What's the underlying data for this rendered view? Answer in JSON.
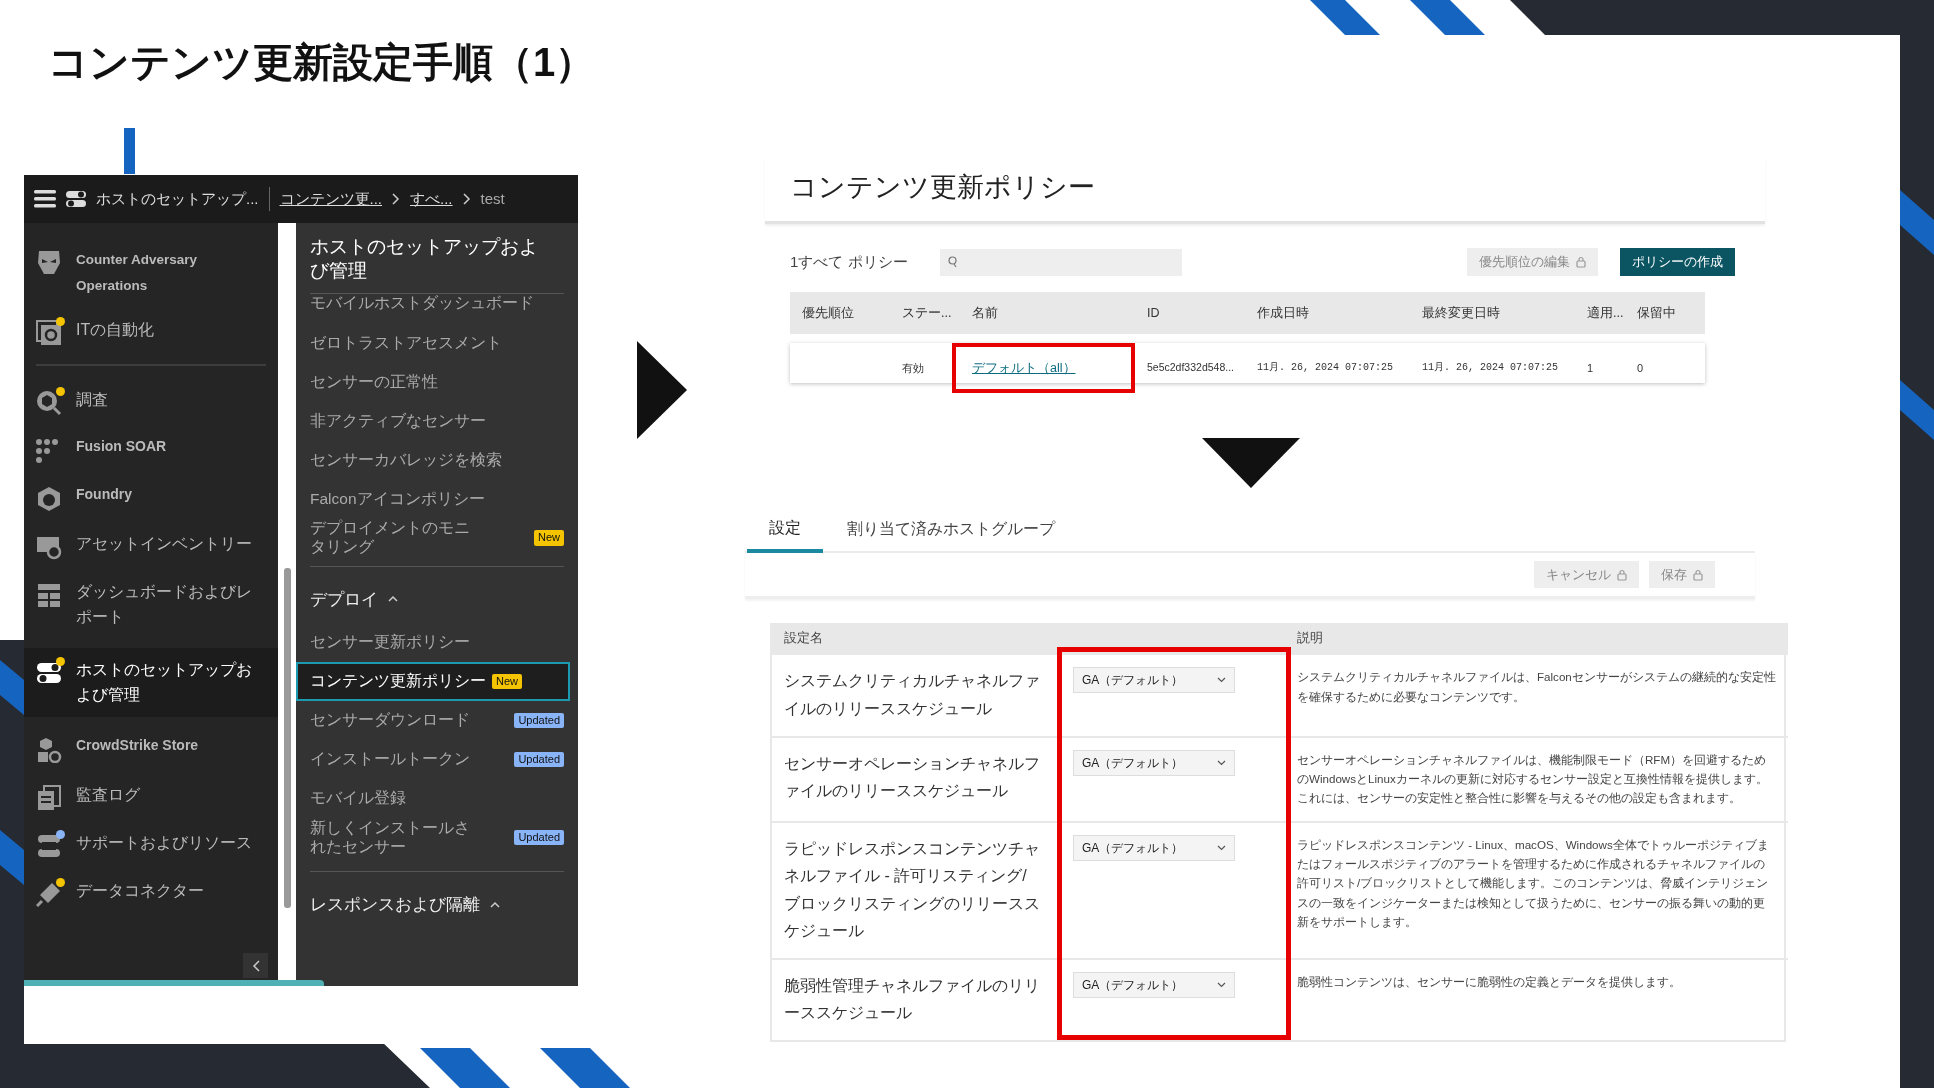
{
  "slide_title": "コンテンツ更新設定手順（1）",
  "console": {
    "breadcrumb": [
      {
        "text": "ホストのセットアップ...",
        "link": false
      },
      {
        "text": "コンテンツ更...",
        "link": true
      },
      {
        "text": "すべ...",
        "link": true
      },
      {
        "text": "test",
        "link": false
      }
    ],
    "nav_groups": [
      {
        "items": [
          {
            "label": "Counter Adversary Operations",
            "selected": false
          },
          {
            "label": "ITの自動化",
            "selected": false,
            "color": "#f5c400"
          }
        ]
      },
      {
        "items": [
          {
            "label": "調査",
            "selected": false,
            "color": "#f5c400"
          },
          {
            "label": "Fusion SOAR",
            "selected": false
          },
          {
            "label": "Foundry",
            "selected": false
          },
          {
            "label": "アセットインベントリー",
            "selected": false
          },
          {
            "label": "ダッシュボードおよびレポート",
            "selected": false
          },
          {
            "label": "ホストのセットアップおよび管理",
            "selected": true,
            "color": "#f5c400"
          },
          {
            "label": "CrowdStrike Store",
            "selected": false
          },
          {
            "label": "監査ログ",
            "selected": false
          },
          {
            "label": "サポートおよびリソース",
            "selected": false,
            "color": "#8ab4f8"
          },
          {
            "label": "データコネクター",
            "selected": false,
            "color": "#f5c400"
          }
        ]
      }
    ],
    "submenu": {
      "title": "ホストのセットアップおよび管理",
      "sections": [
        {
          "items": [
            {
              "label": "モバイルホストダッシュボード",
              "selected": false
            },
            {
              "label": "ゼロトラストアセスメント",
              "selected": false
            },
            {
              "label": "センサーの正常性",
              "selected": false
            },
            {
              "label": "非アクティブなセンサー",
              "selected": false
            },
            {
              "label": "センサーカバレッジを検索",
              "selected": false
            },
            {
              "label": "Falconアイコンポリシー",
              "selected": false
            },
            {
              "label": "デプロイメントのモニタリング",
              "selected": false,
              "badge": {
                "text": "New",
                "kind": "new"
              }
            }
          ]
        },
        {
          "heading": "デプロイ",
          "expanded": true,
          "items": [
            {
              "label": "センサー更新ポリシー",
              "selected": false
            },
            {
              "label": "コンテンツ更新ポリシー",
              "selected": true,
              "badge": {
                "text": "New",
                "kind": "new"
              }
            },
            {
              "label": "センサーダウンロード",
              "selected": false,
              "badge": {
                "text": "Updated",
                "kind": "updated"
              }
            },
            {
              "label": "インストールトークン",
              "selected": false,
              "badge": {
                "text": "Updated",
                "kind": "updated"
              }
            },
            {
              "label": "モバイル登録",
              "selected": false
            },
            {
              "label": "新しくインストールされたセンサー",
              "selected": false,
              "badge": {
                "text": "Updated",
                "kind": "updated"
              }
            }
          ]
        },
        {
          "heading": "レスポンスおよび隔離",
          "expanded": true
        }
      ]
    }
  },
  "policy_list": {
    "title": "コンテンツ更新ポリシー",
    "count_label": "1すべて ポリシー",
    "buttons": [
      {
        "label": "優先順位の編集",
        "locked": true
      },
      {
        "label": "ポリシーの作成",
        "locked": false
      }
    ],
    "columns": [
      "優先順位",
      "ステー...",
      "名前",
      "ID",
      "作成日時",
      "最終変更日時",
      "適用...",
      "保留中"
    ],
    "rows": [
      {
        "status": "有効",
        "name": "デフォルト（all）",
        "id": "5e5c2df332d548...",
        "created": "11月. 26, 2024 07:07:25",
        "modified": "11月. 26, 2024 07:07:25",
        "applied": "1",
        "pending": "0",
        "callout": true
      }
    ]
  },
  "policy_detail": {
    "tabs": [
      {
        "label": "設定",
        "selected": true
      },
      {
        "label": "割り当て済みホストグループ",
        "selected": false
      }
    ],
    "buttons": [
      {
        "label": "キャンセル",
        "locked": true
      },
      {
        "label": "保存",
        "locked": true
      }
    ],
    "columns": [
      "設定名",
      "説明"
    ],
    "callout": true,
    "settings": [
      {
        "name": "システムクリティカルチャネルファイルのリリーススケジュール",
        "value": "GA（デフォルト）",
        "description": "システムクリティカルチャネルファイルは、Falconセンサーがシステムの継続的な安定性を確保するために必要なコンテンツです。"
      },
      {
        "name": "センサーオペレーションチャネルファイルのリリーススケジュール",
        "value": "GA（デフォルト）",
        "description": "センサーオペレーションチャネルファイルは、機能制限モード（RFM）を回避するためのWindowsとLinuxカーネルの更新に対応するセンサー設定と互換性情報を提供します。これには、センサーの安定性と整合性に影響を与えるその他の設定も含まれます。"
      },
      {
        "name": "ラピッドレスポンスコンテンツチャネルファイル - 許可リスティング/ブロックリスティングのリリーススケジュール",
        "value": "GA（デフォルト）",
        "description": "ラピッドレスポンスコンテンツ - Linux、macOS、Windows全体でトゥルーポジティブまたはフォールスポジティブのアラートを管理するために作成されるチャネルファイルの許可リスト/ブロックリストとして機能します。このコンテンツは、脅威インテリジェンスの一致をインジケーターまたは検知として扱うために、センサーの振る舞いの動的更新をサポートします。"
      },
      {
        "name": "脆弱性管理チャネルファイルのリリーススケジュール",
        "value": "GA（デフォルト）",
        "description": "脆弱性コンテンツは、センサーに脆弱性の定義とデータを提供します。"
      }
    ]
  }
}
